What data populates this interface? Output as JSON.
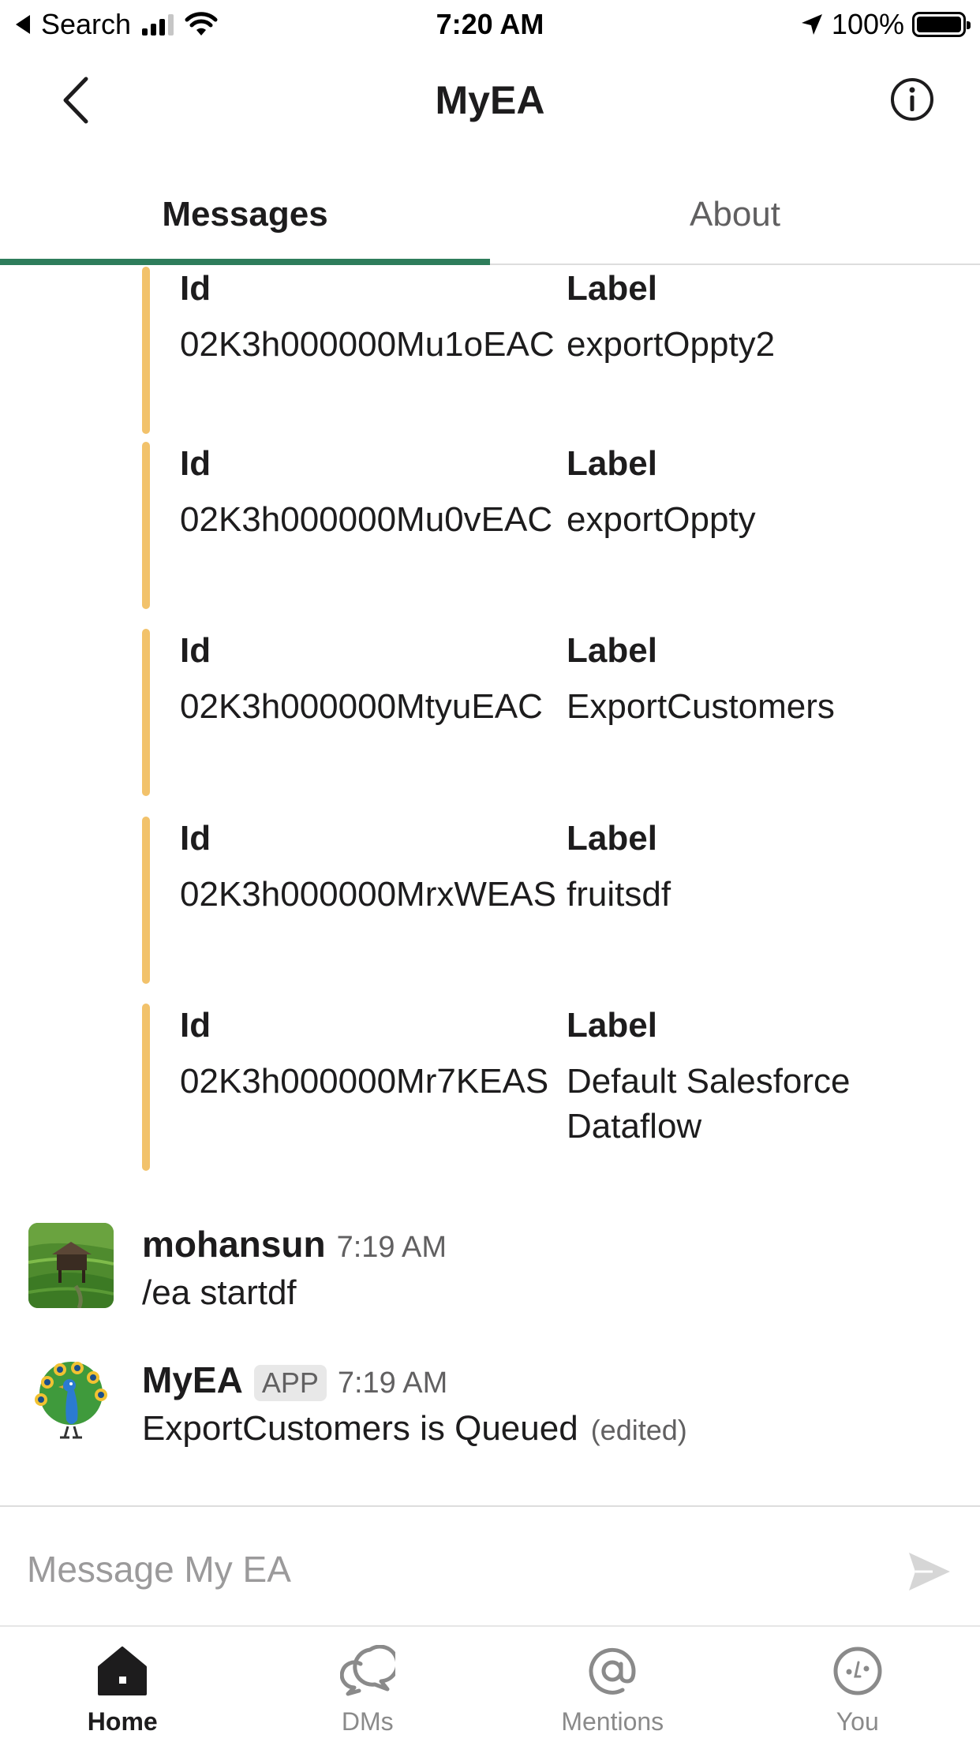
{
  "status_bar": {
    "back_app": "Search",
    "time": "7:20 AM",
    "battery": "100%"
  },
  "header": {
    "title": "MyEA"
  },
  "tabs": [
    {
      "label": "Messages",
      "active": true
    },
    {
      "label": "About",
      "active": false
    }
  ],
  "attachments": [
    {
      "id_title": "Id",
      "id_value": "02K3h000000Mu1oEAC",
      "label_title": "Label",
      "label_value": "exportOppty2"
    },
    {
      "id_title": "Id",
      "id_value": "02K3h000000Mu0vEAC",
      "label_title": "Label",
      "label_value": "exportOppty"
    },
    {
      "id_title": "Id",
      "id_value": "02K3h000000MtyuEAC",
      "label_title": "Label",
      "label_value": "ExportCustomers"
    },
    {
      "id_title": "Id",
      "id_value": "02K3h000000MrxWEAS",
      "label_title": "Label",
      "label_value": "fruitsdf"
    },
    {
      "id_title": "Id",
      "id_value": "02K3h000000Mr7KEAS",
      "label_title": "Label",
      "label_value": "Default Salesforce Dataflow"
    }
  ],
  "messages": [
    {
      "author": "mohansun",
      "time": "7:19 AM",
      "text": "/ea startdf"
    },
    {
      "author": "MyEA",
      "badge": "APP",
      "time": "7:19 AM",
      "text": "ExportCustomers is Queued",
      "edited": "(edited)"
    }
  ],
  "composer": {
    "placeholder": "Message My EA"
  },
  "tabbar": [
    {
      "label": "Home",
      "icon": "home-icon",
      "active": true
    },
    {
      "label": "DMs",
      "icon": "dms-icon",
      "active": false
    },
    {
      "label": "Mentions",
      "icon": "mentions-icon",
      "active": false
    },
    {
      "label": "You",
      "icon": "you-icon",
      "active": false
    }
  ],
  "colors": {
    "accent": "#2e7d5b",
    "attachment_bar": "#f2c26b"
  }
}
